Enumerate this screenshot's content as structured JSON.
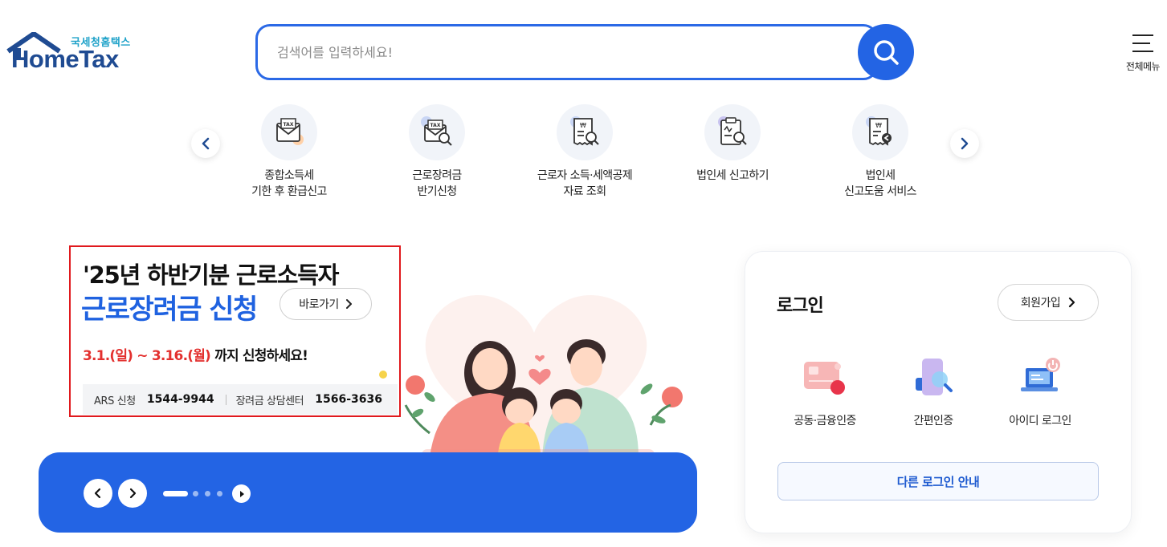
{
  "logo": {
    "sub": "국세청홈택스",
    "main": "HomeTax"
  },
  "search": {
    "placeholder": "검색어를 입력하세요!",
    "value": ""
  },
  "menu": {
    "label": "전체메뉴"
  },
  "quick_menu": {
    "items": [
      {
        "label": "종합소득세\n기한 후 환급신고",
        "icon": "tax-envelope-icon"
      },
      {
        "label": "근로장려금\n반기신청",
        "icon": "tax-search-icon"
      },
      {
        "label": "근로자 소득·세액공제\n자료 조회",
        "icon": "receipt-search-icon"
      },
      {
        "label": "법인세 신고하기",
        "icon": "clipboard-search-icon"
      },
      {
        "label": "법인세\n신고도움 서비스",
        "icon": "receipt-help-icon"
      }
    ]
  },
  "banner": {
    "title_line1": "'25년 하반기분 근로소득자",
    "title_line2": "근로장려금 신청",
    "shortcut_label": "바로가기",
    "period_red": "3.1.(일) ~ 3.16.(월)",
    "period_rest": " 까지 신청하세요!",
    "ars_label": "ARS 신청",
    "ars_number": "1544-9944",
    "center_label": "장려금 상담센터",
    "center_number": "1566-3636"
  },
  "slider": {
    "total_dots": 4,
    "active_index": 0
  },
  "login": {
    "title": "로그인",
    "signup_label": "회원가입",
    "options": [
      {
        "label": "공동·금융인증",
        "icon": "certificate-card-icon"
      },
      {
        "label": "간편인증",
        "icon": "phone-search-icon"
      },
      {
        "label": "아이디 로그인",
        "icon": "laptop-power-icon"
      }
    ],
    "other_login_label": "다른 로그인 안내"
  },
  "colors": {
    "primary": "#2364e4",
    "brand_dark": "#1f4b92",
    "brand_light": "#1fa2c9",
    "highlight_red": "#e3302e",
    "banner_blue_text": "#1f62e0"
  }
}
